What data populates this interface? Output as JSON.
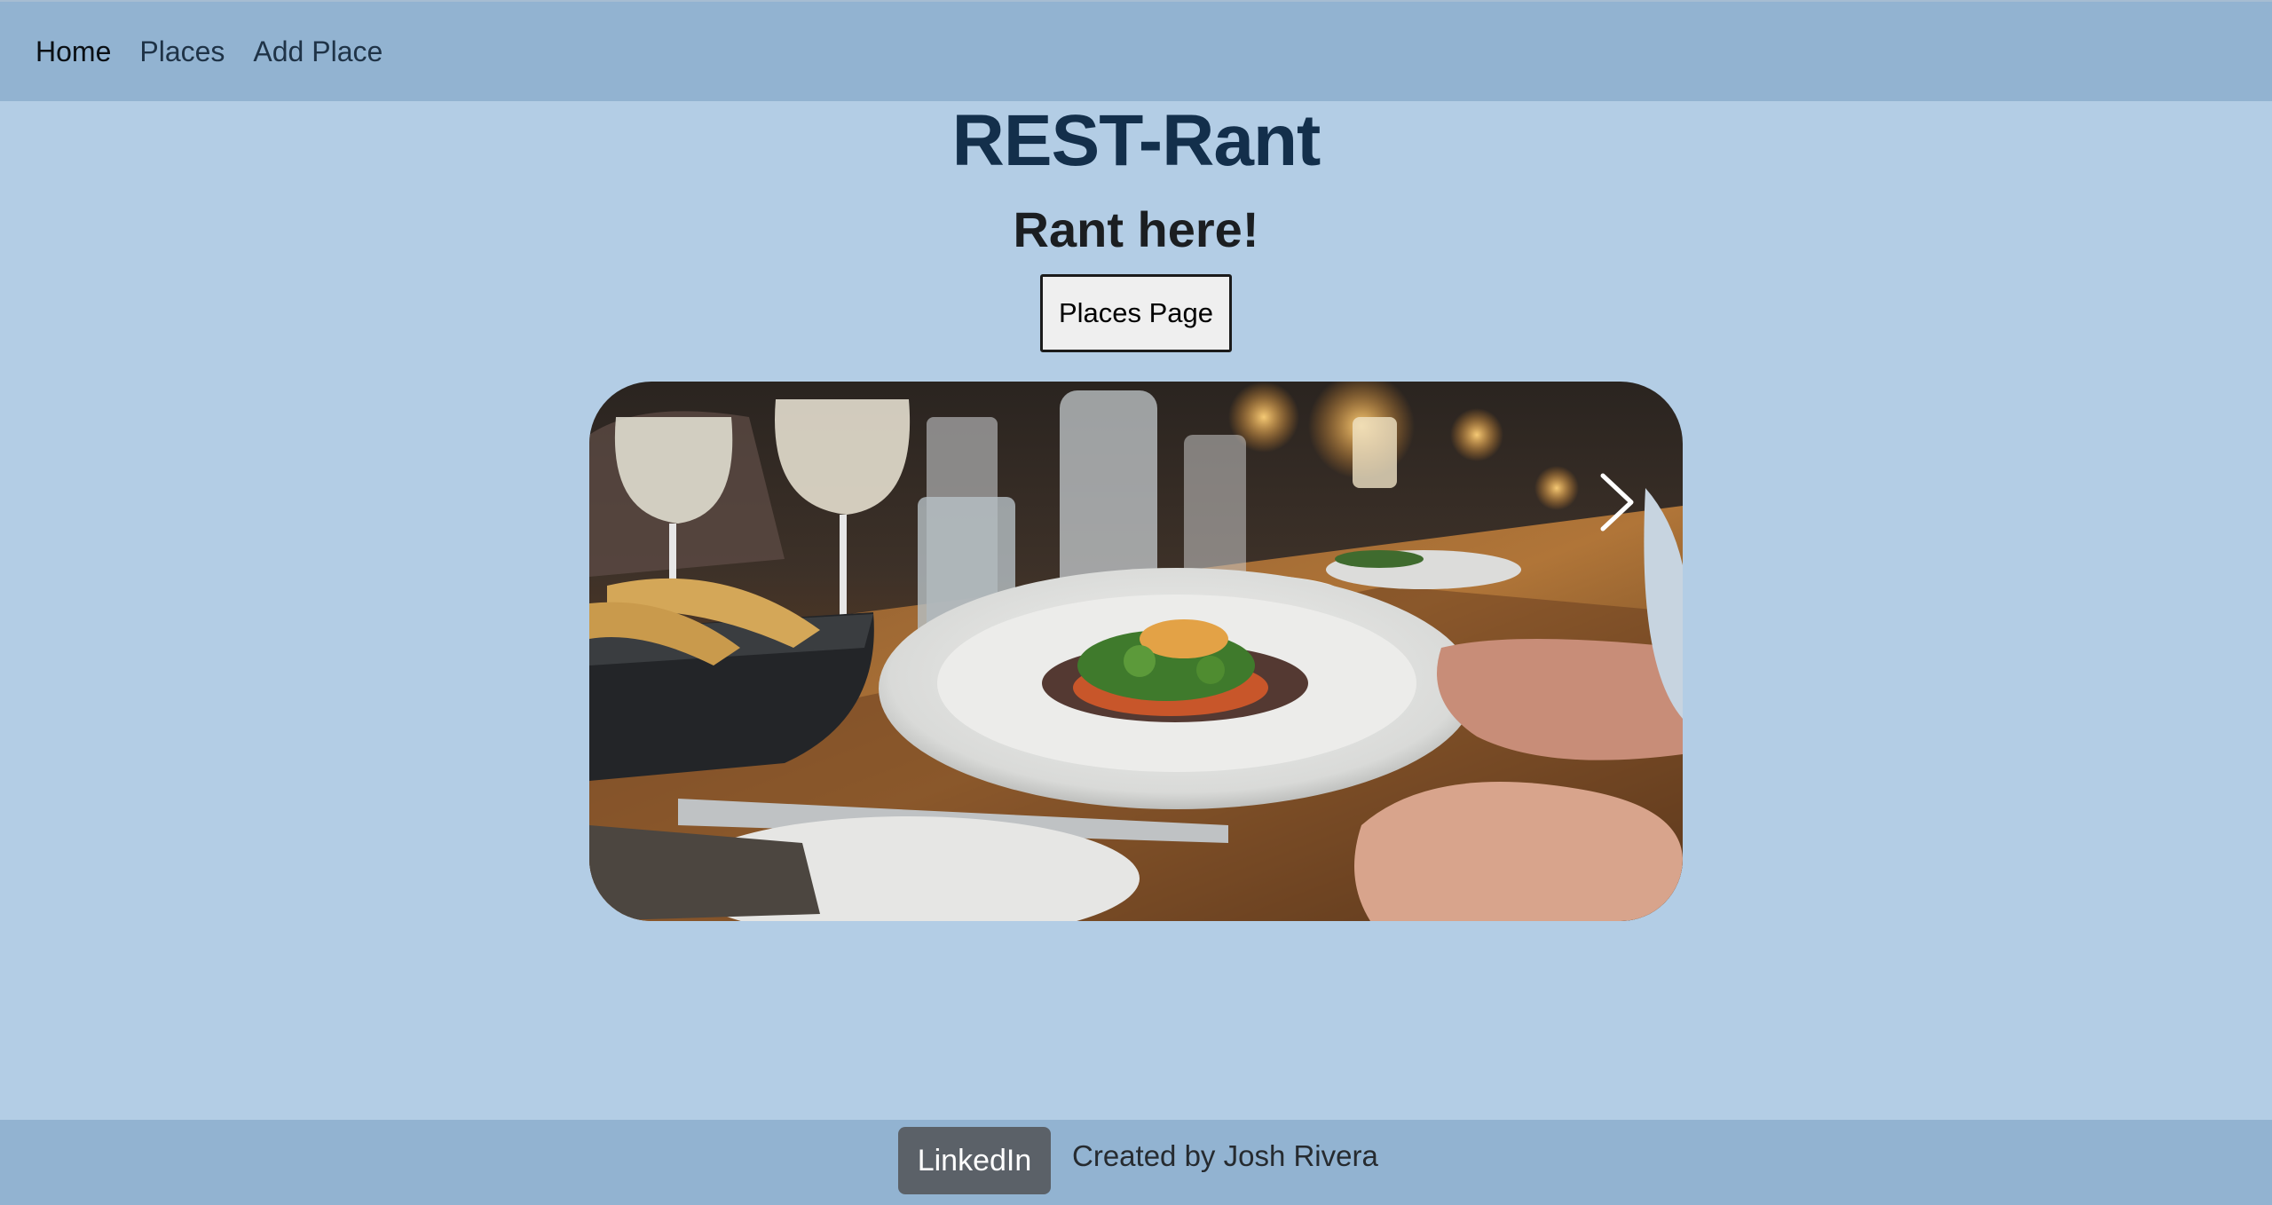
{
  "nav": {
    "items": [
      {
        "label": "Home",
        "active": true
      },
      {
        "label": "Places",
        "active": false
      },
      {
        "label": "Add Place",
        "active": false
      }
    ]
  },
  "hero": {
    "title": "REST-Rant",
    "subtitle": "Rant here!",
    "button_label": "Places Page"
  },
  "carousel": {
    "image_subject": "restaurant table with plated dish, wine glasses and bread basket",
    "next_icon": "chevron-right-icon"
  },
  "footer": {
    "linkedin_label": "LinkedIn",
    "credit": "Created by Josh Rivera"
  },
  "colors": {
    "page_bg": "#b3cde5",
    "navbar_bg": "#92b3d1",
    "title": "#132f4b",
    "linkedin_bg": "#5b6168"
  }
}
